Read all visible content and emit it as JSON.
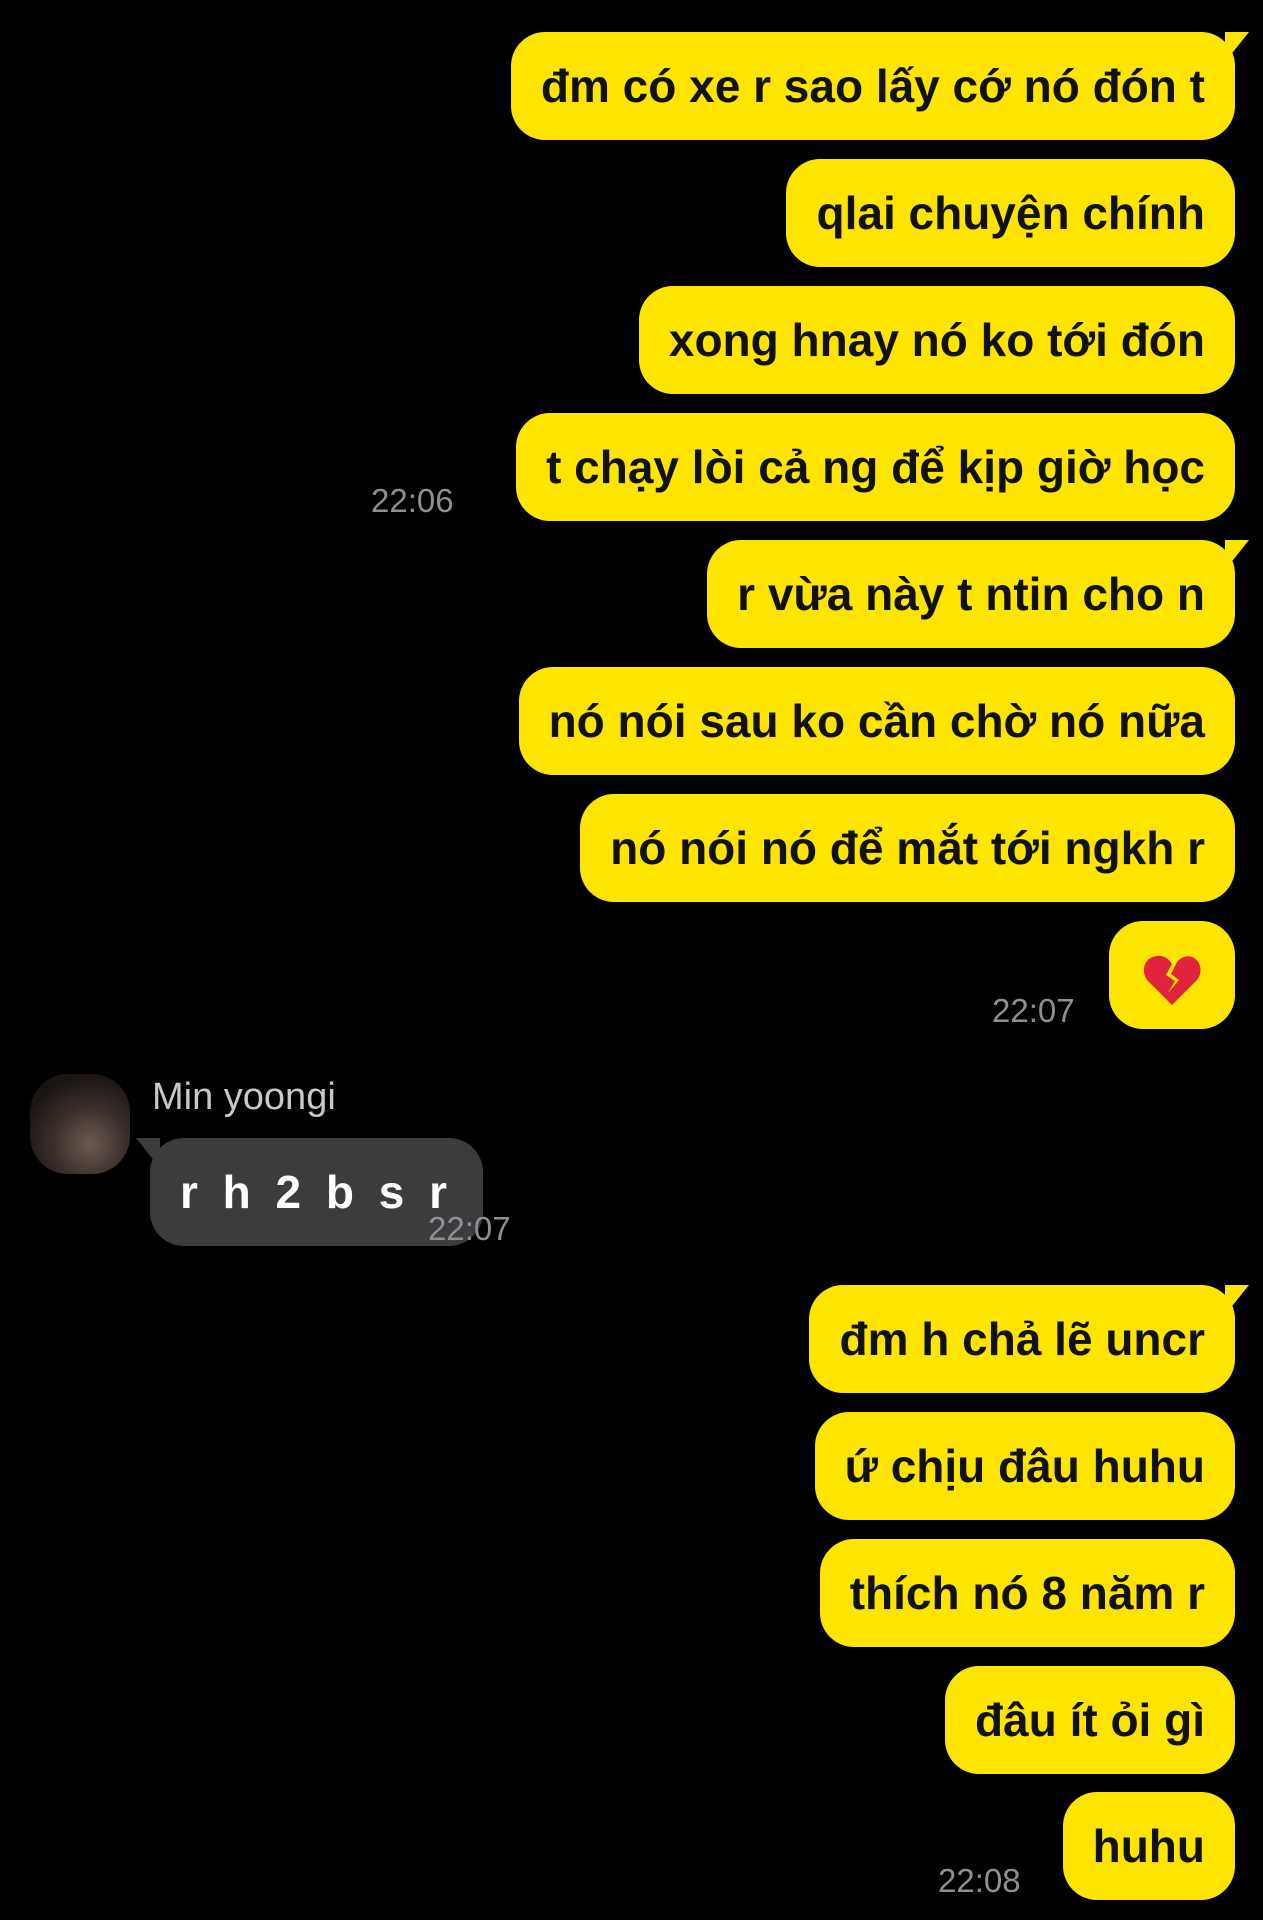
{
  "colors": {
    "background": "#000000",
    "outgoing_bubble": "#fee500",
    "incoming_bubble": "#3c3c3e",
    "timestamp": "#8e8e93"
  },
  "messages_block_1": [
    {
      "text": "đm có xe r sao lấy cớ nó đón t"
    },
    {
      "text": "qlai chuyện chính"
    },
    {
      "text": "xong hnay nó ko tới đón"
    },
    {
      "text": "t chạy lòi cả ng để kịp giờ học",
      "time": "22:06"
    },
    {
      "text": "r vừa này t ntin cho n"
    },
    {
      "text": "nó nói sau ko cần chờ nó nữa"
    },
    {
      "text": "nó nói nó để mắt tới ngkh r"
    },
    {
      "icon": "broken-heart-emoji",
      "time": "22:07"
    }
  ],
  "incoming": {
    "sender": "Min yoongi",
    "avatar": "profile-photo",
    "text": "r h 2 b s r",
    "time": "22:07"
  },
  "messages_block_2": [
    {
      "text": "đm h chả lẽ uncr"
    },
    {
      "text": "ứ chịu đâu huhu"
    },
    {
      "text": "thích nó 8 năm r"
    },
    {
      "text": "đâu ít ỏi gì"
    },
    {
      "text": "huhu",
      "time": "22:08"
    }
  ]
}
